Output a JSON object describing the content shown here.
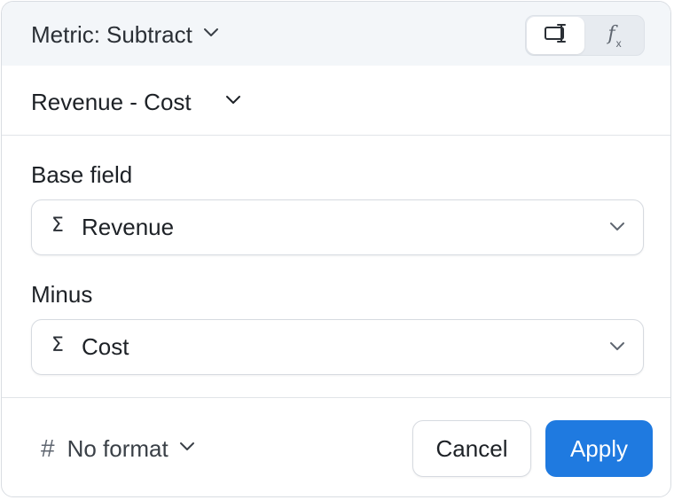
{
  "header": {
    "metric_label": "Metric:",
    "metric_value": "Subtract",
    "modes": [
      {
        "name": "builder",
        "icon": "builder-mode-icon",
        "active": true
      },
      {
        "name": "formula",
        "icon": "function-fx-icon",
        "glyph": "f",
        "sub": "x",
        "active": false
      }
    ]
  },
  "expression": {
    "text": "Revenue - Cost"
  },
  "fields": {
    "base": {
      "label": "Base field",
      "icon": "sigma-icon",
      "glyph": "Σ",
      "value": "Revenue"
    },
    "minus": {
      "label": "Minus",
      "icon": "sigma-icon",
      "glyph": "Σ",
      "value": "Cost"
    }
  },
  "footer": {
    "format_icon": "hash-icon",
    "format_glyph": "#",
    "format_label": "No format",
    "cancel_label": "Cancel",
    "apply_label": "Apply"
  },
  "colors": {
    "accent": "#1f7ae0",
    "header_bg": "#f3f6f9",
    "border": "#d6dae0"
  }
}
